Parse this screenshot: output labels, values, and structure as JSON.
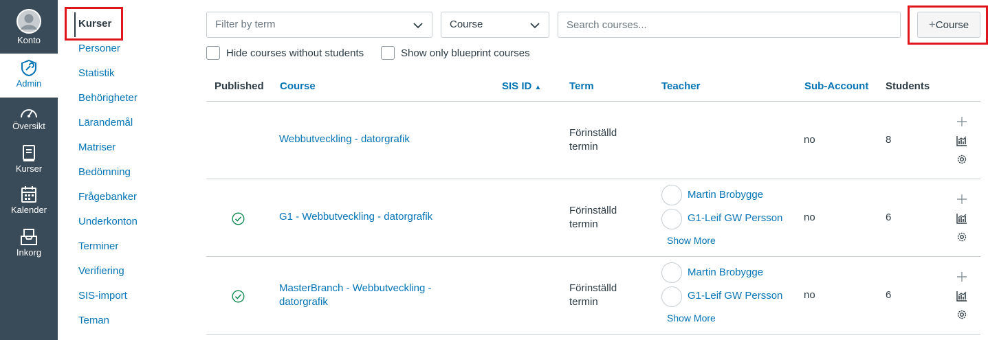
{
  "global_nav": [
    {
      "label": "Konto",
      "icon": "user-avatar-icon"
    },
    {
      "label": "Admin",
      "icon": "admin-shield-icon"
    },
    {
      "label": "Översikt",
      "icon": "dashboard-icon"
    },
    {
      "label": "Kurser",
      "icon": "courses-book-icon"
    },
    {
      "label": "Kalender",
      "icon": "calendar-icon"
    },
    {
      "label": "Inkorg",
      "icon": "inbox-icon"
    }
  ],
  "sub_nav": [
    "Kurser",
    "Personer",
    "Statistik",
    "Behörigheter",
    "Lärandemål",
    "Matriser",
    "Bedömning",
    "Frågebanker",
    "Underkonton",
    "Terminer",
    "Verifiering",
    "SIS-import",
    "Teman"
  ],
  "filters": {
    "term_placeholder": "Filter by term",
    "type_value": "Course",
    "search_placeholder": "Search courses...",
    "add_course_label": "Course",
    "hide_without_students": "Hide courses without students",
    "only_blueprint": "Show only blueprint courses"
  },
  "table": {
    "headers": {
      "published": "Published",
      "course": "Course",
      "sis_id": "SIS ID",
      "term": "Term",
      "teacher": "Teacher",
      "subaccount": "Sub-Account",
      "students": "Students"
    },
    "sort_indicator": "▲",
    "rows": [
      {
        "published": false,
        "course": "Webbutveckling - datorgrafik",
        "term": "Förinställd termin",
        "teachers": [],
        "show_more": "",
        "subaccount": "no",
        "students": "8"
      },
      {
        "published": true,
        "course": "G1 - Webbutveckling - datorgrafik",
        "term": "Förinställd termin",
        "teachers": [
          "Martin Brobygge",
          "G1-Leif GW Persson"
        ],
        "show_more": "Show More",
        "subaccount": "no",
        "students": "6"
      },
      {
        "published": true,
        "course": "MasterBranch - Webbutveckling - datorgrafik",
        "term": "Förinställd termin",
        "teachers": [
          "Martin Brobygge",
          "G1-Leif GW Persson"
        ],
        "show_more": "Show More",
        "subaccount": "no",
        "students": "6"
      }
    ]
  },
  "colors": {
    "nav_bg": "#394b58",
    "link": "#0374b5",
    "highlight": "#e0161d",
    "published": "#0b874b"
  }
}
